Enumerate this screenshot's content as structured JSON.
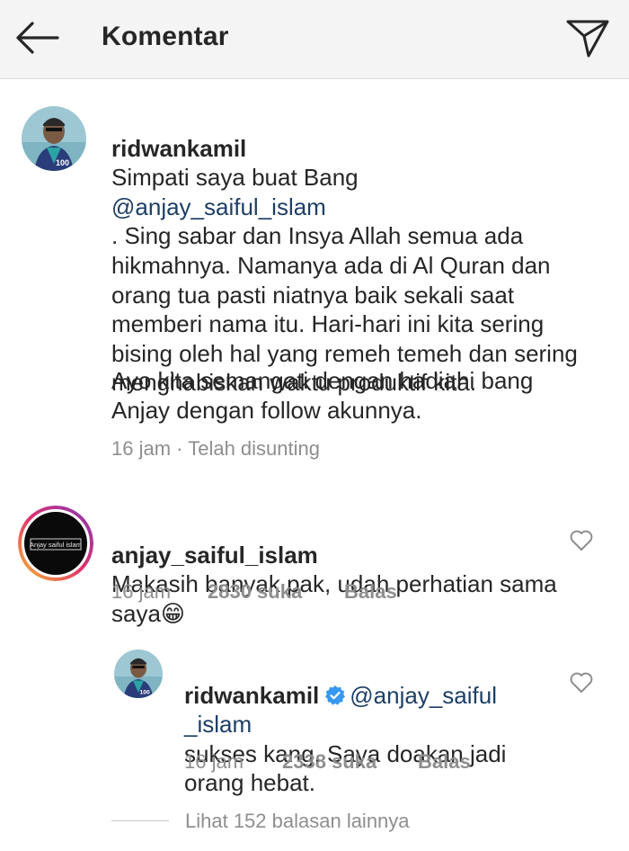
{
  "header": {
    "title": "Komentar",
    "back_icon": "arrow-left-icon",
    "send_icon": "paper-plane-icon"
  },
  "comments": [
    {
      "username": "ridwankamil",
      "text_before_mention": "Simpati saya buat Bang",
      "mention": "@anjay_saiful_islam",
      "text_after_mention": ". Sing sabar dan Insya Allah semua ada hikmahnya. Namanya ada di Al Quran dan orang tua pasti niatnya baik sekali saat memberi nama itu. Hari-hari ini kita sering bising oleh hal yang remeh temeh dan sering menghabiskan waktu produktif kita.",
      "paragraph2": "Ayo kita semangati dengan hadiahi bang Anjay dengan follow akunnya.",
      "time": "16 jam",
      "edited": "· Telah disunting"
    },
    {
      "username": "anjay_saiful_islam",
      "avatar_text": "Anjay saiful islam",
      "text": "Makasih banyak pak, udah perhatian sama saya😁",
      "time": "16 jam",
      "likes": "2830 suka",
      "reply": "Balas"
    },
    {
      "username": "ridwankamil",
      "verified_icon": "verified-badge-icon",
      "mention": "@anjay_saiful _islam",
      "text": "sukses kang. Saya doakan jadi orang hebat.",
      "time": "16 jam",
      "likes": "2338 suka",
      "reply": "Balas"
    }
  ],
  "view_more": "Lihat 152 balasan lainnya",
  "colors": {
    "header_bg": "#f4f4f4",
    "text": "#262626",
    "meta": "#8e8e8e",
    "mention": "#1e3f66",
    "verified": "#3897f0"
  }
}
